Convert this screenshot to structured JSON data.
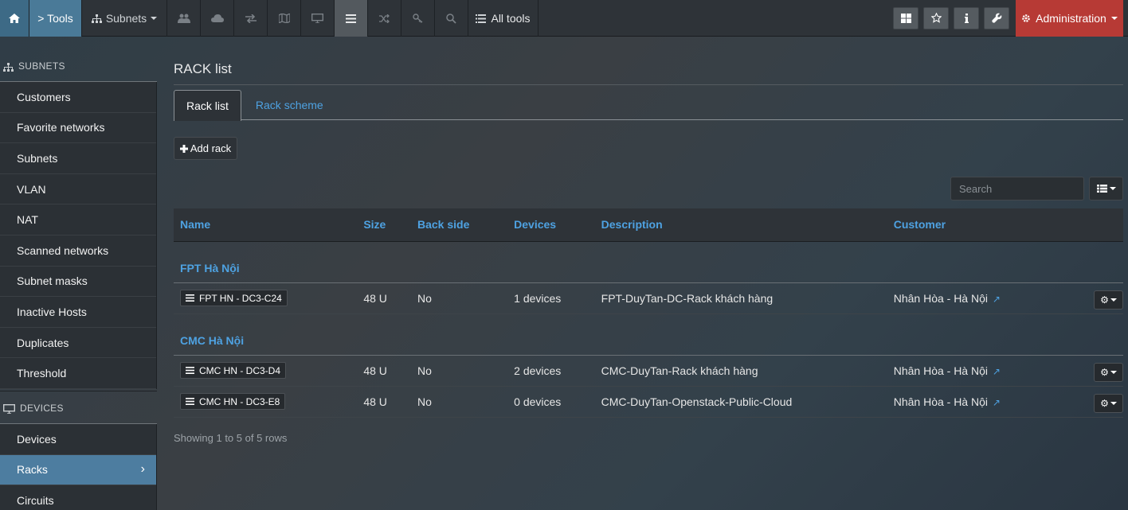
{
  "topbar": {
    "tools_label": "> Tools",
    "subnets_label": "Subnets",
    "all_tools_label": "All tools",
    "admin_label": "Administration"
  },
  "sidebar": {
    "subnets_heading": "SUBNETS",
    "subnet_items": [
      {
        "label": "Customers"
      },
      {
        "label": "Favorite networks"
      },
      {
        "label": "Subnets"
      },
      {
        "label": "VLAN"
      },
      {
        "label": "NAT"
      },
      {
        "label": "Scanned networks"
      },
      {
        "label": "Subnet masks"
      },
      {
        "label": "Inactive Hosts"
      },
      {
        "label": "Duplicates"
      },
      {
        "label": "Threshold"
      }
    ],
    "devices_heading": "DEVICES",
    "device_items": [
      {
        "label": "Devices"
      },
      {
        "label": "Racks"
      },
      {
        "label": "Circuits"
      }
    ]
  },
  "main": {
    "title": "RACK list",
    "tabs": [
      {
        "label": "Rack list"
      },
      {
        "label": "Rack scheme"
      }
    ],
    "add_rack_label": "Add rack",
    "search_placeholder": "Search",
    "columns": [
      "Name",
      "Size",
      "Back side",
      "Devices",
      "Description",
      "Customer"
    ],
    "groups": [
      {
        "name": "FPT Hà Nội",
        "rows": [
          {
            "name": "FPT HN - DC3-C24",
            "size": "48 U",
            "back": "No",
            "devices": "1 devices",
            "description": "FPT-DuyTan-DC-Rack khách hàng",
            "customer": "Nhân Hòa - Hà Nội"
          }
        ]
      },
      {
        "name": "CMC Hà Nội",
        "rows": [
          {
            "name": "CMC HN - DC3-D4",
            "size": "48 U",
            "back": "No",
            "devices": "2 devices",
            "description": "CMC-DuyTan-Rack khách hàng",
            "customer": "Nhân Hòa - Hà Nội"
          },
          {
            "name": "CMC HN - DC3-E8",
            "size": "48 U",
            "back": "No",
            "devices": "0 devices",
            "description": "CMC-DuyTan-Openstack-Public-Cloud",
            "customer": "Nhân Hòa - Hà Nội"
          }
        ]
      }
    ],
    "footer": "Showing 1 to 5 of 5 rows"
  },
  "colors": {
    "accent": "#4ea2e2",
    "admin": "#b73a35",
    "active_nav": "#4d7da0"
  }
}
